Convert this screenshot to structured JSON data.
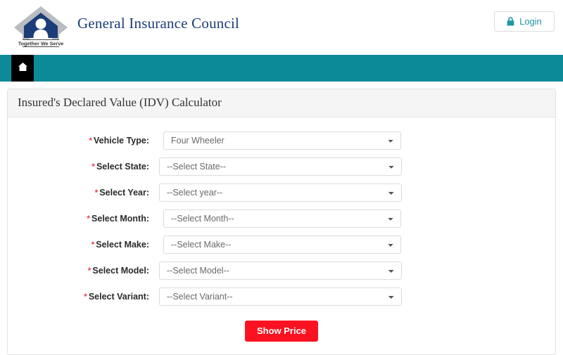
{
  "header": {
    "brand_title": "General Insurance Council",
    "logo_tagline": "Together We Serve",
    "logo_icon": "diamond-person-logo",
    "login": {
      "label": "Login",
      "icon": "lock-icon"
    }
  },
  "navbar": {
    "home_icon": "home-icon",
    "background_color": "#0d8a98",
    "home_tile_color": "#000000"
  },
  "card": {
    "title": "Insured's Declared Value (IDV) Calculator"
  },
  "form": {
    "required_marker": "*",
    "fields": [
      {
        "label": "Vehicle Type:",
        "value": "Four Wheeler",
        "name": "vehicle-type"
      },
      {
        "label": "Select State:",
        "value": "--Select State--",
        "name": "state"
      },
      {
        "label": "Select Year:",
        "value": "--Select year--",
        "name": "year"
      },
      {
        "label": "Select Month:",
        "value": "--Select Month--",
        "name": "month"
      },
      {
        "label": "Select Make:",
        "value": "--Select Make--",
        "name": "make"
      },
      {
        "label": "Select Model:",
        "value": "--Select Model--",
        "name": "model"
      },
      {
        "label": "Select Variant:",
        "value": "--Select Variant--",
        "name": "variant"
      }
    ],
    "submit": {
      "label": "Show Price",
      "color": "#fb1220"
    }
  },
  "colors": {
    "brand_navy": "#1c3d78",
    "teal": "#0d8a98",
    "accent_red": "#fb1220",
    "required_red": "#f0414f",
    "card_header_bg": "#f5f5f5"
  }
}
